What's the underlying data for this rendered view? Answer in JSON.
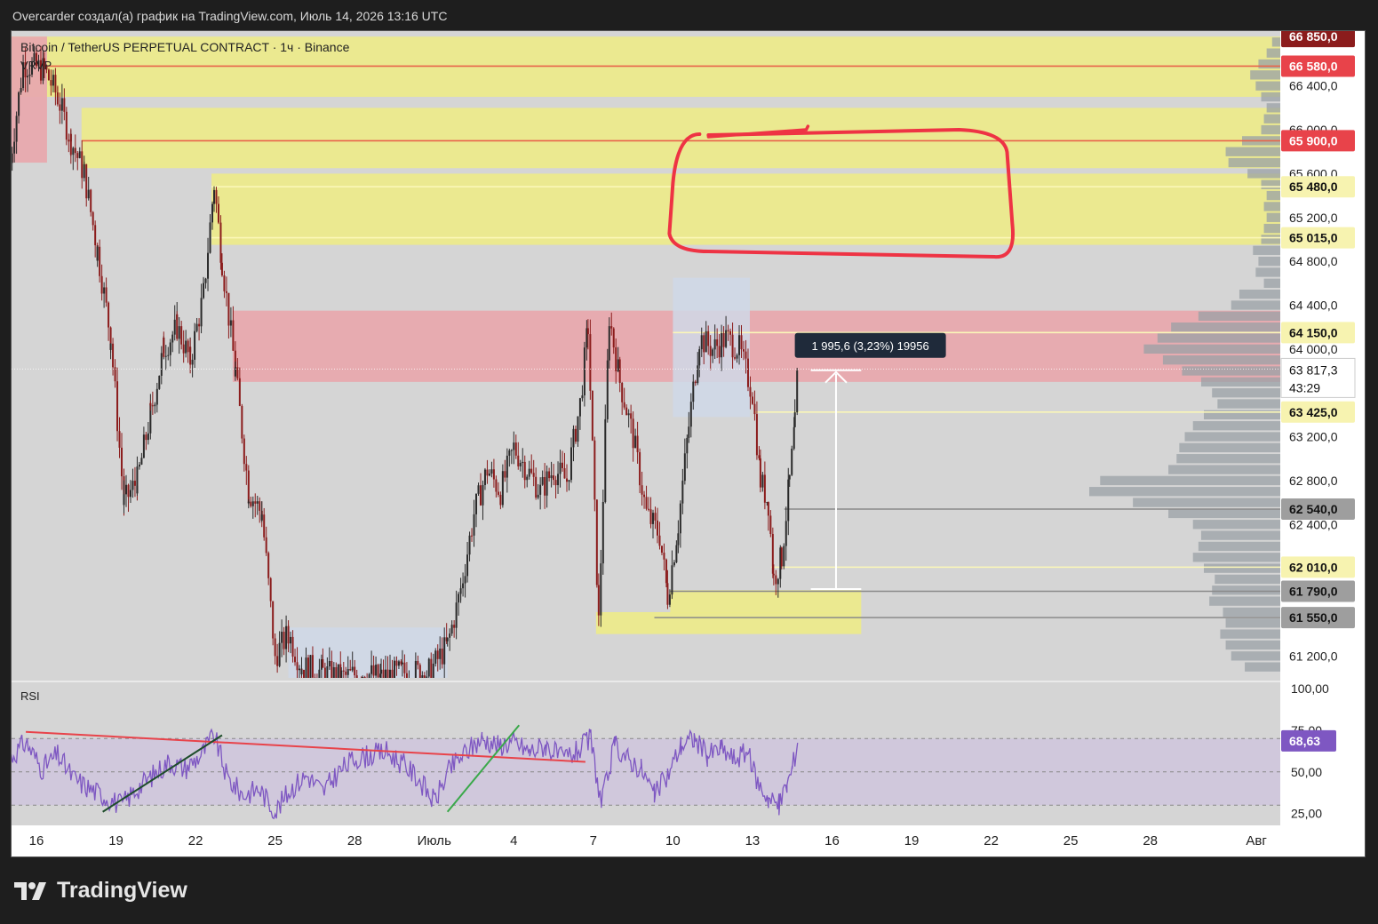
{
  "header": {
    "attribution": "Overcarder создал(а) график на TradingView.com, Июль 14, 2026 13:16 UTC"
  },
  "chart_info": {
    "symbol": "Bitcoin / TetherUS PERPETUAL CONTRACT · 1ч · Binance",
    "indicator": "VRVP",
    "rsi_title": "RSI"
  },
  "footer": {
    "brand": "TradingView"
  },
  "colors": {
    "chart_bg": "#d5d5d5",
    "yellow_zone": "#ecea8c",
    "red_zone": "#e8a9ae",
    "blue_zone": "#cfd8e8",
    "red_line": "#e8634a",
    "yellow_line": "#f5f0a0",
    "gray_line": "#8a8a8a",
    "rsi_line": "#7e57c2",
    "rsi_band": "#cfc6dd",
    "drawing_red": "#ee3344",
    "up_candle": "#2a2a2a",
    "down_candle": "#8b1c1c",
    "volume_profile": "#9aa0a6"
  },
  "chart_data": {
    "type": "candlestick",
    "title": "Bitcoin / TetherUS PERPETUAL CONTRACT · 1ч · Binance",
    "ylim": [
      61000,
      66900
    ],
    "y_ticks": [
      "66 400,0",
      "66 000,0",
      "65 600,0",
      "65 200,0",
      "64 800,0",
      "64 400,0",
      "64 000,0",
      "63 200,0",
      "62 800,0",
      "62 400,0",
      "61 200,0"
    ],
    "y_ticks_values": [
      66400,
      66000,
      65600,
      65200,
      64800,
      64400,
      64000,
      63200,
      62800,
      62400,
      61200
    ],
    "x_ticks": [
      "16",
      "19",
      "22",
      "25",
      "28",
      "Июль",
      "4",
      "7",
      "10",
      "13",
      "16",
      "19",
      "22",
      "25",
      "28",
      "Авг"
    ],
    "x_ticks_days": [
      16,
      19,
      22,
      25,
      28,
      31,
      34,
      37,
      40,
      43,
      46,
      49,
      52,
      55,
      58,
      62
    ],
    "price_path": [
      [
        15.0,
        65700
      ],
      [
        15.5,
        66600
      ],
      [
        16.3,
        66550
      ],
      [
        16.8,
        66300
      ],
      [
        17.3,
        65900
      ],
      [
        17.8,
        65600
      ],
      [
        18.3,
        64900
      ],
      [
        18.8,
        64100
      ],
      [
        19.3,
        62600
      ],
      [
        19.8,
        62800
      ],
      [
        20.3,
        63400
      ],
      [
        20.8,
        64000
      ],
      [
        21.3,
        64200
      ],
      [
        21.8,
        63900
      ],
      [
        22.3,
        64500
      ],
      [
        22.7,
        65500
      ],
      [
        23.0,
        64800
      ],
      [
        23.5,
        63800
      ],
      [
        24.0,
        62700
      ],
      [
        24.5,
        62500
      ],
      [
        25.0,
        61200
      ],
      [
        25.5,
        61400
      ],
      [
        26.0,
        61100
      ],
      [
        26.8,
        61050
      ],
      [
        27.5,
        61000
      ],
      [
        28.3,
        61050
      ],
      [
        29.0,
        61000
      ],
      [
        29.8,
        61050
      ],
      [
        30.8,
        61050
      ],
      [
        31.5,
        61300
      ],
      [
        32.0,
        61800
      ],
      [
        32.5,
        62500
      ],
      [
        33.0,
        62900
      ],
      [
        33.5,
        62700
      ],
      [
        34.0,
        63100
      ],
      [
        34.5,
        62900
      ],
      [
        35.0,
        62700
      ],
      [
        35.5,
        62900
      ],
      [
        36.0,
        62800
      ],
      [
        36.5,
        63500
      ],
      [
        36.8,
        64200
      ],
      [
        37.2,
        61500
      ],
      [
        37.6,
        64300
      ],
      [
        38.0,
        63700
      ],
      [
        38.5,
        63200
      ],
      [
        39.0,
        62500
      ],
      [
        39.5,
        62300
      ],
      [
        39.8,
        61750
      ],
      [
        40.2,
        62400
      ],
      [
        40.6,
        63300
      ],
      [
        41.0,
        64100
      ],
      [
        41.5,
        64000
      ],
      [
        42.0,
        64100
      ],
      [
        42.5,
        64000
      ],
      [
        43.0,
        63600
      ],
      [
        43.3,
        62800
      ],
      [
        43.6,
        62600
      ],
      [
        43.8,
        61900
      ],
      [
        44.1,
        62100
      ],
      [
        44.4,
        62800
      ],
      [
        44.6,
        63300
      ],
      [
        44.7,
        63800
      ]
    ],
    "current_price": "63 817,3",
    "countdown": "43:29",
    "price_labels": [
      {
        "text": "66 850,0",
        "value": 66850,
        "bg": "#8b1c1c",
        "fg": "#ffffff"
      },
      {
        "text": "66 580,0",
        "value": 66580,
        "bg": "#e8434a",
        "fg": "#ffffff"
      },
      {
        "text": "65 900,0",
        "value": 65900,
        "bg": "#e8434a",
        "fg": "#ffffff"
      },
      {
        "text": "65 480,0",
        "value": 65480,
        "bg": "#f7f3b0",
        "fg": "#111111"
      },
      {
        "text": "65 015,0",
        "value": 65015,
        "bg": "#f7f3b0",
        "fg": "#111111"
      },
      {
        "text": "64 150,0",
        "value": 64150,
        "bg": "#f7f3b0",
        "fg": "#111111"
      },
      {
        "text": "63 425,0",
        "value": 63425,
        "bg": "#f7f3b0",
        "fg": "#111111"
      },
      {
        "text": "62 540,0",
        "value": 62540,
        "bg": "#9e9e9e",
        "fg": "#111111"
      },
      {
        "text": "62 010,0",
        "value": 62010,
        "bg": "#f7f3b0",
        "fg": "#111111"
      },
      {
        "text": "61 790,0",
        "value": 61790,
        "bg": "#9e9e9e",
        "fg": "#111111"
      },
      {
        "text": "61 550,0",
        "value": 61550,
        "bg": "#9e9e9e",
        "fg": "#111111"
      }
    ],
    "zones": [
      {
        "kind": "yellow",
        "x0": 14.8,
        "x1": 64,
        "y0": 66300,
        "y1": 66850
      },
      {
        "kind": "red",
        "x0": 14.8,
        "x1": 16.4,
        "y0": 65700,
        "y1": 66850
      },
      {
        "kind": "yellow",
        "x0": 17.7,
        "x1": 64,
        "y0": 65650,
        "y1": 66200
      },
      {
        "kind": "yellow",
        "x0": 22.6,
        "x1": 64,
        "y0": 64950,
        "y1": 65600
      },
      {
        "kind": "red",
        "x0": 23.4,
        "x1": 64,
        "y0": 63700,
        "y1": 64350
      },
      {
        "kind": "blue",
        "x0": 40.0,
        "x1": 42.9,
        "y0": 63380,
        "y1": 64650
      },
      {
        "kind": "blue",
        "x0": 25.5,
        "x1": 31.5,
        "y0": 61000,
        "y1": 61460
      },
      {
        "kind": "yellow",
        "x0": 37.1,
        "x1": 47.1,
        "y0": 61400,
        "y1": 61600
      },
      {
        "kind": "yellow",
        "x0": 39.9,
        "x1": 47.1,
        "y0": 61590,
        "y1": 61800
      }
    ],
    "hlines": [
      {
        "kind": "red",
        "x0": 16.4,
        "value": 66580
      },
      {
        "kind": "red",
        "x0": 17.7,
        "value": 65900
      },
      {
        "kind": "yellow",
        "x0": 22.6,
        "value": 65480
      },
      {
        "kind": "yellow",
        "x0": 22.6,
        "value": 65015
      },
      {
        "kind": "yellow",
        "x0": 40.0,
        "value": 64150
      },
      {
        "kind": "yellow",
        "x0": 43.1,
        "value": 63425
      },
      {
        "kind": "gray",
        "x0": 44.2,
        "value": 62540
      },
      {
        "kind": "yellow",
        "x0": 43.7,
        "value": 62010
      },
      {
        "kind": "gray",
        "x0": 39.9,
        "value": 61790
      },
      {
        "kind": "gray",
        "x0": 39.3,
        "value": 61550
      }
    ],
    "measure": {
      "label": "1 995,6 (3,23%) 19956",
      "from": 61810,
      "to": 63806,
      "x0": 45.2,
      "x1": 47.1
    },
    "volume_profile": {
      "bucket_values": [
        66800,
        66700,
        66600,
        66500,
        66400,
        66300,
        66200,
        66100,
        66000,
        65900,
        65800,
        65700,
        65600,
        65500,
        65400,
        65300,
        65200,
        65100,
        65000,
        64900,
        64800,
        64700,
        64600,
        64500,
        64400,
        64300,
        64200,
        64100,
        64000,
        63900,
        63800,
        63700,
        63600,
        63500,
        63400,
        63300,
        63200,
        63100,
        63000,
        62900,
        62800,
        62700,
        62600,
        62500,
        62400,
        62300,
        62200,
        62100,
        62000,
        61900,
        61800,
        61700,
        61600,
        61500,
        61400,
        61300,
        61200,
        61100
      ],
      "bucket_volumes": [
        6,
        10,
        16,
        22,
        18,
        14,
        10,
        12,
        14,
        28,
        40,
        38,
        24,
        14,
        10,
        12,
        10,
        12,
        14,
        20,
        16,
        18,
        12,
        30,
        36,
        60,
        80,
        90,
        100,
        86,
        72,
        58,
        50,
        46,
        56,
        64,
        70,
        74,
        76,
        82,
        132,
        140,
        108,
        82,
        64,
        58,
        60,
        64,
        56,
        48,
        50,
        52,
        42,
        40,
        44,
        40,
        36,
        26
      ],
      "max_volume": 140
    },
    "rsi": {
      "ylim": [
        20,
        100
      ],
      "ticks": [
        "100,00",
        "75,00",
        "50,00",
        "25,00"
      ],
      "tick_values": [
        100,
        75,
        50,
        25
      ],
      "band": [
        30,
        70
      ],
      "current": "68,63",
      "series": [
        [
          15.0,
          58
        ],
        [
          15.6,
          68
        ],
        [
          16.2,
          52
        ],
        [
          16.8,
          60
        ],
        [
          17.4,
          46
        ],
        [
          18.0,
          40
        ],
        [
          18.6,
          35
        ],
        [
          19.2,
          30
        ],
        [
          19.8,
          40
        ],
        [
          20.4,
          48
        ],
        [
          21.0,
          56
        ],
        [
          21.6,
          52
        ],
        [
          22.2,
          60
        ],
        [
          22.7,
          72
        ],
        [
          23.2,
          46
        ],
        [
          23.8,
          36
        ],
        [
          24.4,
          40
        ],
        [
          25.0,
          26
        ],
        [
          25.6,
          40
        ],
        [
          26.2,
          48
        ],
        [
          26.8,
          38
        ],
        [
          27.4,
          50
        ],
        [
          28.0,
          58
        ],
        [
          28.6,
          60
        ],
        [
          29.2,
          62
        ],
        [
          29.8,
          55
        ],
        [
          30.4,
          46
        ],
        [
          31.0,
          32
        ],
        [
          31.6,
          52
        ],
        [
          32.2,
          62
        ],
        [
          32.8,
          70
        ],
        [
          33.4,
          66
        ],
        [
          34.0,
          68
        ],
        [
          34.6,
          62
        ],
        [
          35.2,
          66
        ],
        [
          35.8,
          58
        ],
        [
          36.4,
          62
        ],
        [
          36.9,
          70
        ],
        [
          37.3,
          30
        ],
        [
          37.8,
          66
        ],
        [
          38.3,
          58
        ],
        [
          38.8,
          52
        ],
        [
          39.3,
          36
        ],
        [
          39.8,
          48
        ],
        [
          40.3,
          66
        ],
        [
          40.8,
          70
        ],
        [
          41.3,
          60
        ],
        [
          41.8,
          64
        ],
        [
          42.3,
          58
        ],
        [
          42.8,
          62
        ],
        [
          43.2,
          44
        ],
        [
          43.6,
          34
        ],
        [
          44.0,
          30
        ],
        [
          44.3,
          42
        ],
        [
          44.5,
          52
        ],
        [
          44.7,
          68
        ]
      ],
      "trendlines": [
        {
          "color": "#e8434a",
          "x0": 15.6,
          "y0": 74,
          "x1": 36.7,
          "y1": 56
        },
        {
          "color": "#1e4d2b",
          "x0": 18.5,
          "y0": 26,
          "x1": 23.0,
          "y1": 72
        },
        {
          "color": "#3aa84a",
          "x0": 31.5,
          "y0": 26,
          "x1": 34.2,
          "y1": 78
        }
      ]
    },
    "annotation_ellipse": {
      "x0": 40.0,
      "x1": 52.8,
      "y0": 64890,
      "y1": 66000
    }
  }
}
